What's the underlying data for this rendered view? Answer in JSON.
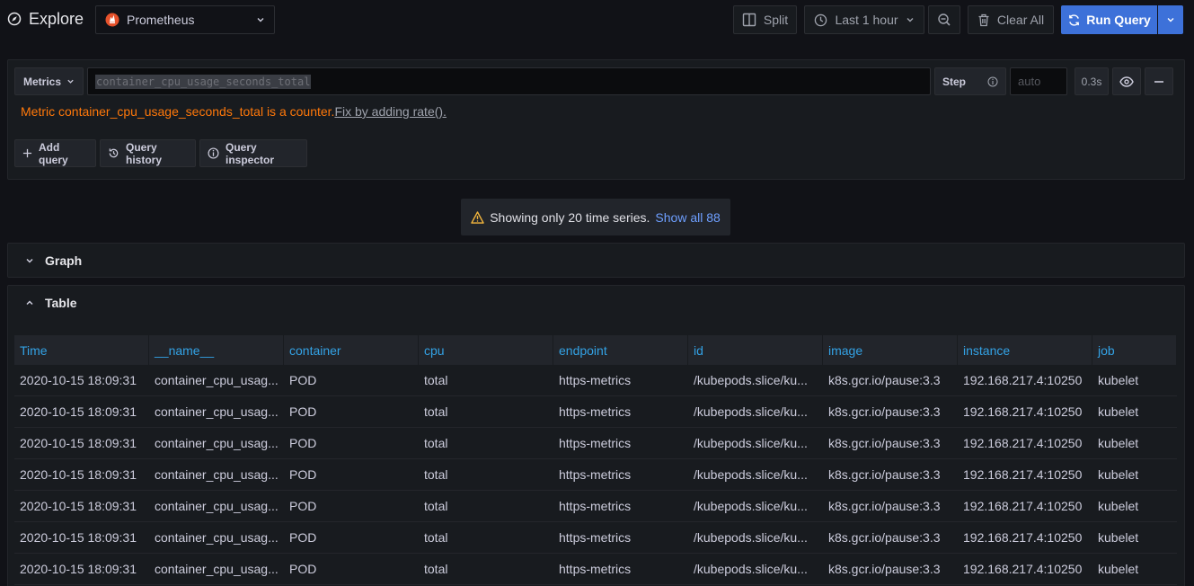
{
  "header": {
    "title": "Explore",
    "datasource": "Prometheus",
    "split_label": "Split",
    "time_range": "Last 1 hour",
    "clear_all_label": "Clear All",
    "run_query_label": "Run Query"
  },
  "query": {
    "metrics_label": "Metrics",
    "expression": "container_cpu_usage_seconds_total",
    "step_label": "Step",
    "step_placeholder": "auto",
    "query_time": "0.3s",
    "warning_text": "Metric container_cpu_usage_seconds_total is a counter.",
    "warning_fix": "Fix by adding rate().",
    "add_query_label": "Add query",
    "query_history_label": "Query history",
    "query_inspector_label": "Query inspector"
  },
  "notice": {
    "text": "Showing only 20 time series.",
    "link": "Show all 88"
  },
  "sections": {
    "graph": "Graph",
    "table": "Table"
  },
  "table": {
    "columns": [
      "Time",
      "__name__",
      "container",
      "cpu",
      "endpoint",
      "id",
      "image",
      "instance",
      "job"
    ],
    "rows": [
      [
        "2020-10-15 18:09:31",
        "container_cpu_usag...",
        "POD",
        "total",
        "https-metrics",
        "/kubepods.slice/ku...",
        "k8s.gcr.io/pause:3.3",
        "192.168.217.4:10250",
        "kubelet"
      ],
      [
        "2020-10-15 18:09:31",
        "container_cpu_usag...",
        "POD",
        "total",
        "https-metrics",
        "/kubepods.slice/ku...",
        "k8s.gcr.io/pause:3.3",
        "192.168.217.4:10250",
        "kubelet"
      ],
      [
        "2020-10-15 18:09:31",
        "container_cpu_usag...",
        "POD",
        "total",
        "https-metrics",
        "/kubepods.slice/ku...",
        "k8s.gcr.io/pause:3.3",
        "192.168.217.4:10250",
        "kubelet"
      ],
      [
        "2020-10-15 18:09:31",
        "container_cpu_usag...",
        "POD",
        "total",
        "https-metrics",
        "/kubepods.slice/ku...",
        "k8s.gcr.io/pause:3.3",
        "192.168.217.4:10250",
        "kubelet"
      ],
      [
        "2020-10-15 18:09:31",
        "container_cpu_usag...",
        "POD",
        "total",
        "https-metrics",
        "/kubepods.slice/ku...",
        "k8s.gcr.io/pause:3.3",
        "192.168.217.4:10250",
        "kubelet"
      ],
      [
        "2020-10-15 18:09:31",
        "container_cpu_usag...",
        "POD",
        "total",
        "https-metrics",
        "/kubepods.slice/ku...",
        "k8s.gcr.io/pause:3.3",
        "192.168.217.4:10250",
        "kubelet"
      ],
      [
        "2020-10-15 18:09:31",
        "container_cpu_usag...",
        "POD",
        "total",
        "https-metrics",
        "/kubepods.slice/ku...",
        "k8s.gcr.io/pause:3.3",
        "192.168.217.4:10250",
        "kubelet"
      ]
    ]
  },
  "colors": {
    "accent": "#3d71d9",
    "warning": "#ff780a",
    "link": "#6e9fff",
    "column_header": "#33a2e5",
    "prometheus": "#e6522c"
  }
}
